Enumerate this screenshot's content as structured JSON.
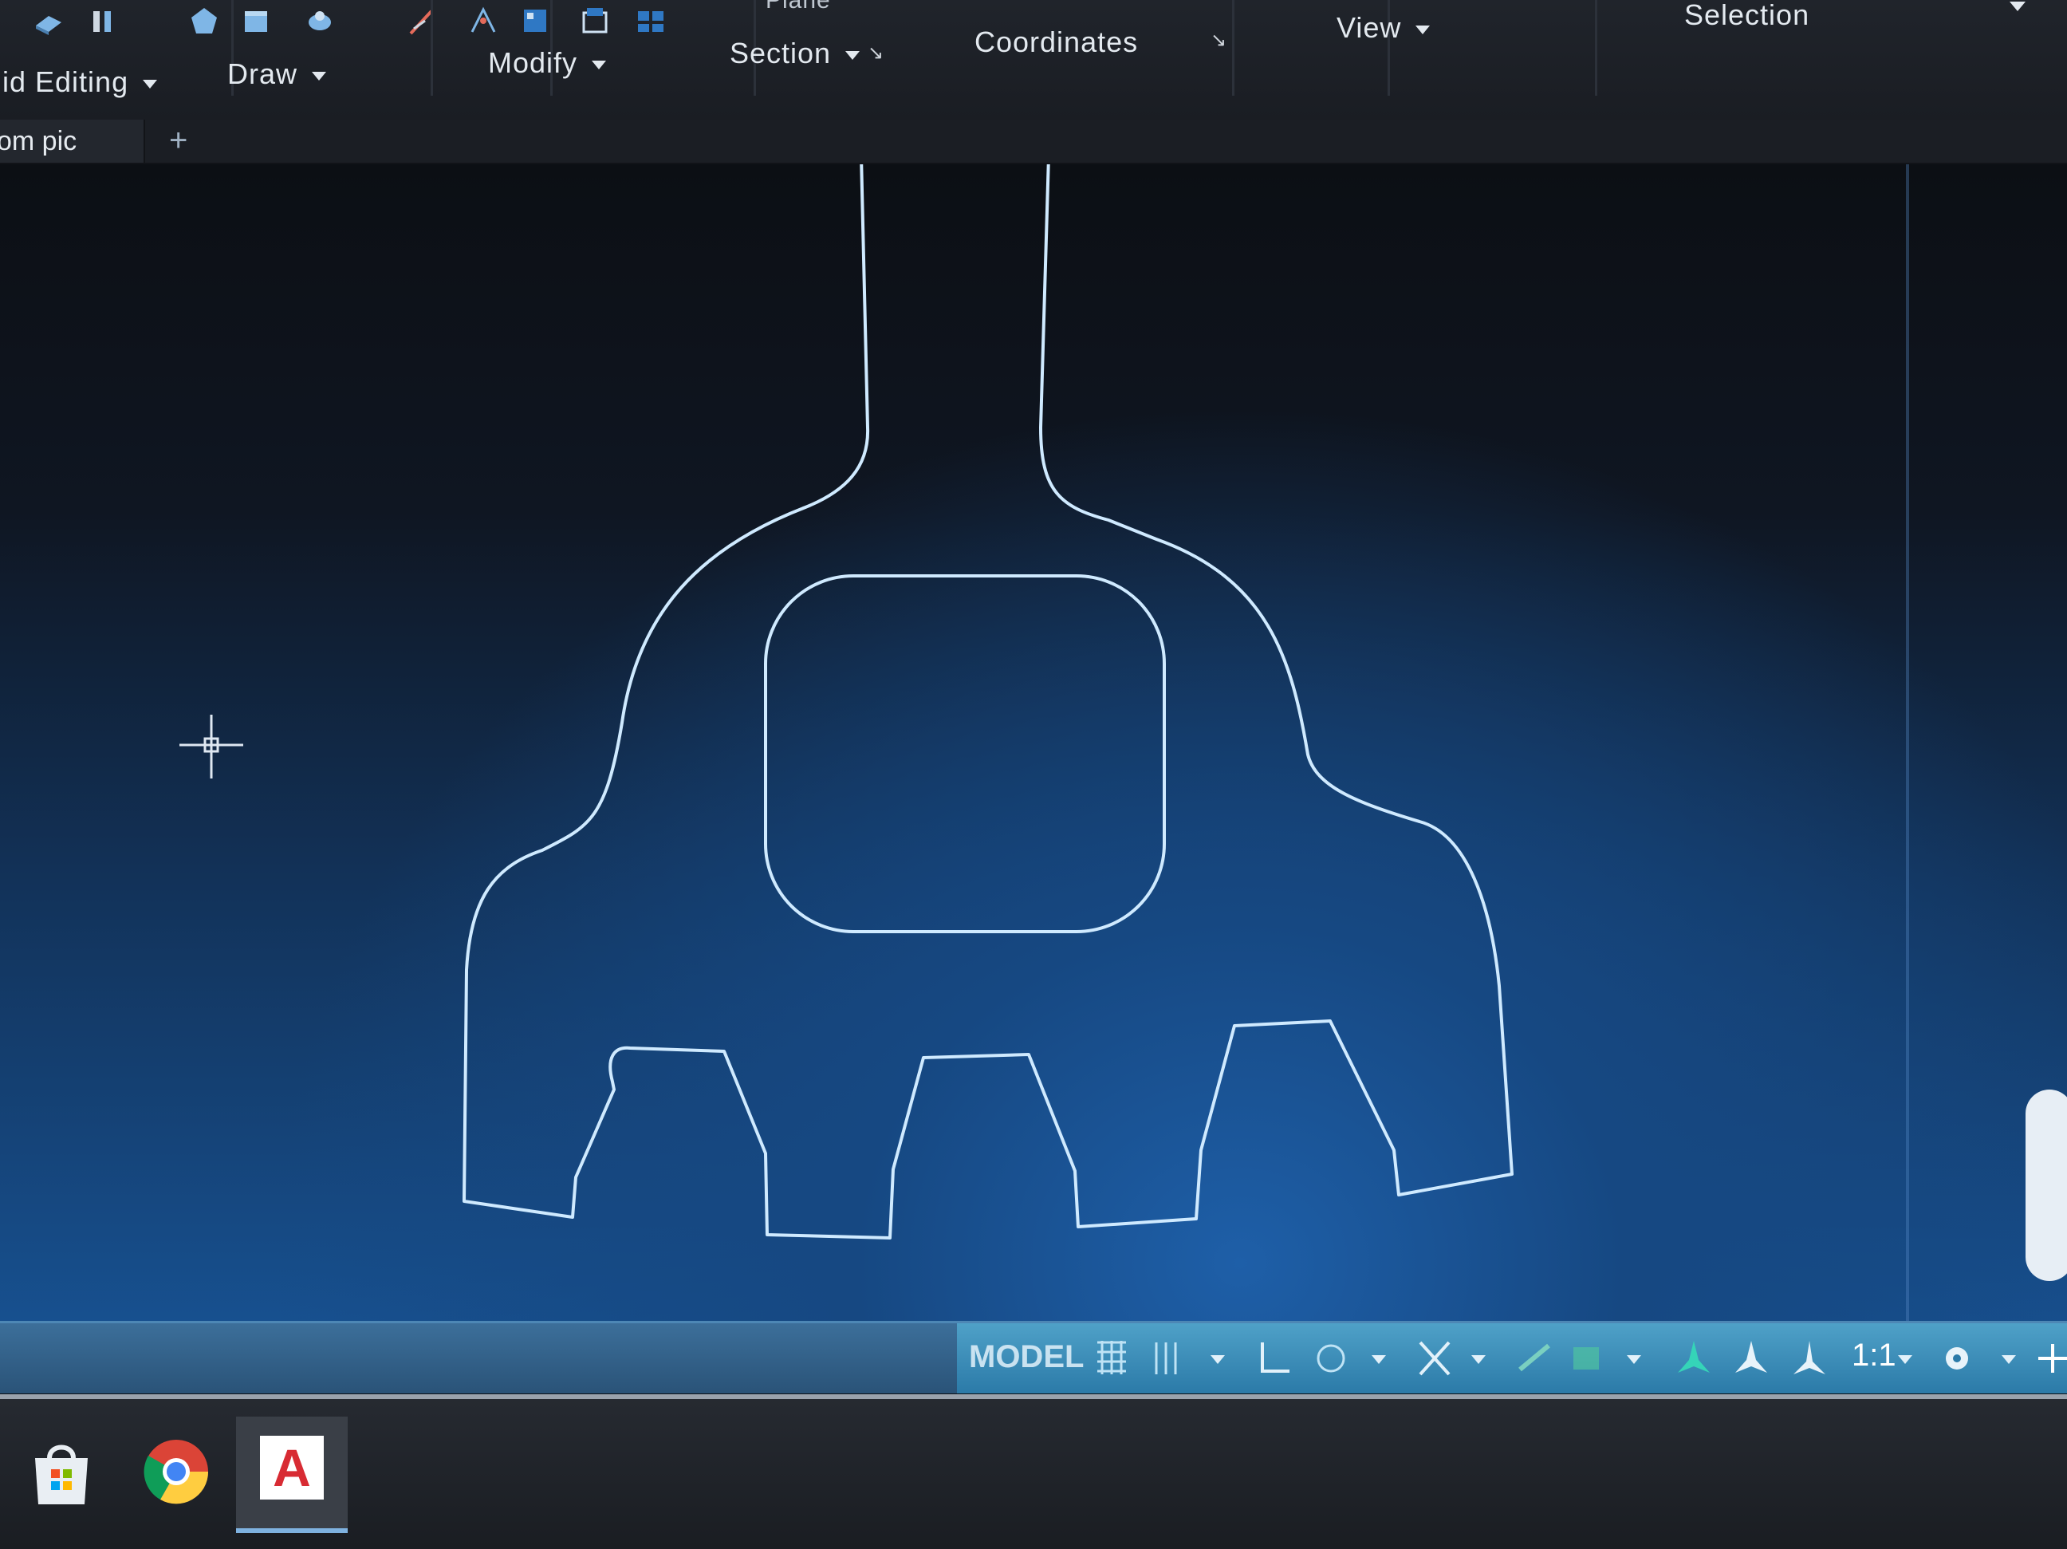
{
  "ribbon": {
    "panels": [
      {
        "label": "lid Editing",
        "id": "solid-editing"
      },
      {
        "label": "Draw",
        "id": "draw"
      },
      {
        "label": "Modify",
        "id": "modify"
      },
      {
        "label": "Section",
        "id": "section"
      },
      {
        "label": "Coordinates",
        "id": "coordinates"
      },
      {
        "label": "View",
        "id": "view"
      },
      {
        "label": "Selection",
        "id": "selection"
      }
    ],
    "partial_label": "Plane",
    "launcher_glyph": "↘"
  },
  "tabs": {
    "current_file": "om pic",
    "add_glyph": "+"
  },
  "status": {
    "model": "MODEL",
    "scale": "1:1"
  },
  "colors": {
    "drawing_line": "#cfeaff",
    "status_bg": "#2b7aa8",
    "autocad_red": "#d82b33"
  },
  "taskbar": {
    "items": [
      {
        "icon": "windows-store-icon"
      },
      {
        "icon": "chrome-icon"
      },
      {
        "icon": "autocad-icon",
        "glyph": "A"
      }
    ]
  }
}
